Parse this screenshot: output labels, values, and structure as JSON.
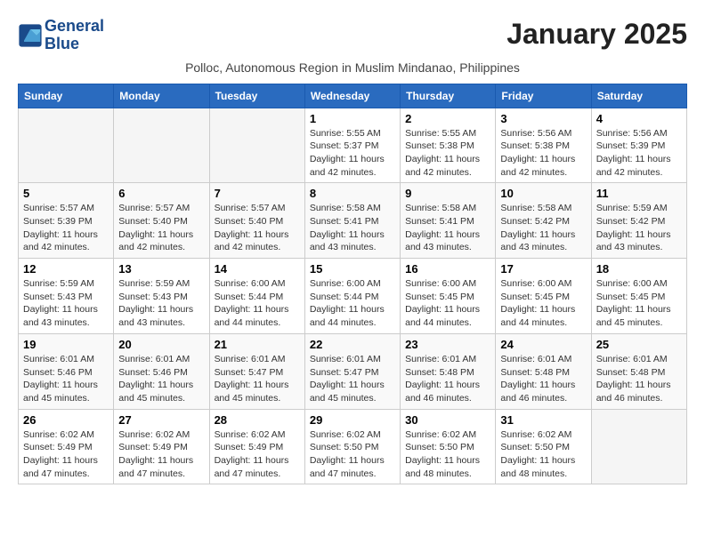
{
  "header": {
    "logo_line1": "General",
    "logo_line2": "Blue",
    "month_title": "January 2025",
    "subtitle": "Polloc, Autonomous Region in Muslim Mindanao, Philippines"
  },
  "weekdays": [
    "Sunday",
    "Monday",
    "Tuesday",
    "Wednesday",
    "Thursday",
    "Friday",
    "Saturday"
  ],
  "weeks": [
    [
      {
        "day": "",
        "info": ""
      },
      {
        "day": "",
        "info": ""
      },
      {
        "day": "",
        "info": ""
      },
      {
        "day": "1",
        "info": "Sunrise: 5:55 AM\nSunset: 5:37 PM\nDaylight: 11 hours\nand 42 minutes."
      },
      {
        "day": "2",
        "info": "Sunrise: 5:55 AM\nSunset: 5:38 PM\nDaylight: 11 hours\nand 42 minutes."
      },
      {
        "day": "3",
        "info": "Sunrise: 5:56 AM\nSunset: 5:38 PM\nDaylight: 11 hours\nand 42 minutes."
      },
      {
        "day": "4",
        "info": "Sunrise: 5:56 AM\nSunset: 5:39 PM\nDaylight: 11 hours\nand 42 minutes."
      }
    ],
    [
      {
        "day": "5",
        "info": "Sunrise: 5:57 AM\nSunset: 5:39 PM\nDaylight: 11 hours\nand 42 minutes."
      },
      {
        "day": "6",
        "info": "Sunrise: 5:57 AM\nSunset: 5:40 PM\nDaylight: 11 hours\nand 42 minutes."
      },
      {
        "day": "7",
        "info": "Sunrise: 5:57 AM\nSunset: 5:40 PM\nDaylight: 11 hours\nand 42 minutes."
      },
      {
        "day": "8",
        "info": "Sunrise: 5:58 AM\nSunset: 5:41 PM\nDaylight: 11 hours\nand 43 minutes."
      },
      {
        "day": "9",
        "info": "Sunrise: 5:58 AM\nSunset: 5:41 PM\nDaylight: 11 hours\nand 43 minutes."
      },
      {
        "day": "10",
        "info": "Sunrise: 5:58 AM\nSunset: 5:42 PM\nDaylight: 11 hours\nand 43 minutes."
      },
      {
        "day": "11",
        "info": "Sunrise: 5:59 AM\nSunset: 5:42 PM\nDaylight: 11 hours\nand 43 minutes."
      }
    ],
    [
      {
        "day": "12",
        "info": "Sunrise: 5:59 AM\nSunset: 5:43 PM\nDaylight: 11 hours\nand 43 minutes."
      },
      {
        "day": "13",
        "info": "Sunrise: 5:59 AM\nSunset: 5:43 PM\nDaylight: 11 hours\nand 43 minutes."
      },
      {
        "day": "14",
        "info": "Sunrise: 6:00 AM\nSunset: 5:44 PM\nDaylight: 11 hours\nand 44 minutes."
      },
      {
        "day": "15",
        "info": "Sunrise: 6:00 AM\nSunset: 5:44 PM\nDaylight: 11 hours\nand 44 minutes."
      },
      {
        "day": "16",
        "info": "Sunrise: 6:00 AM\nSunset: 5:45 PM\nDaylight: 11 hours\nand 44 minutes."
      },
      {
        "day": "17",
        "info": "Sunrise: 6:00 AM\nSunset: 5:45 PM\nDaylight: 11 hours\nand 44 minutes."
      },
      {
        "day": "18",
        "info": "Sunrise: 6:00 AM\nSunset: 5:45 PM\nDaylight: 11 hours\nand 45 minutes."
      }
    ],
    [
      {
        "day": "19",
        "info": "Sunrise: 6:01 AM\nSunset: 5:46 PM\nDaylight: 11 hours\nand 45 minutes."
      },
      {
        "day": "20",
        "info": "Sunrise: 6:01 AM\nSunset: 5:46 PM\nDaylight: 11 hours\nand 45 minutes."
      },
      {
        "day": "21",
        "info": "Sunrise: 6:01 AM\nSunset: 5:47 PM\nDaylight: 11 hours\nand 45 minutes."
      },
      {
        "day": "22",
        "info": "Sunrise: 6:01 AM\nSunset: 5:47 PM\nDaylight: 11 hours\nand 45 minutes."
      },
      {
        "day": "23",
        "info": "Sunrise: 6:01 AM\nSunset: 5:48 PM\nDaylight: 11 hours\nand 46 minutes."
      },
      {
        "day": "24",
        "info": "Sunrise: 6:01 AM\nSunset: 5:48 PM\nDaylight: 11 hours\nand 46 minutes."
      },
      {
        "day": "25",
        "info": "Sunrise: 6:01 AM\nSunset: 5:48 PM\nDaylight: 11 hours\nand 46 minutes."
      }
    ],
    [
      {
        "day": "26",
        "info": "Sunrise: 6:02 AM\nSunset: 5:49 PM\nDaylight: 11 hours\nand 47 minutes."
      },
      {
        "day": "27",
        "info": "Sunrise: 6:02 AM\nSunset: 5:49 PM\nDaylight: 11 hours\nand 47 minutes."
      },
      {
        "day": "28",
        "info": "Sunrise: 6:02 AM\nSunset: 5:49 PM\nDaylight: 11 hours\nand 47 minutes."
      },
      {
        "day": "29",
        "info": "Sunrise: 6:02 AM\nSunset: 5:50 PM\nDaylight: 11 hours\nand 47 minutes."
      },
      {
        "day": "30",
        "info": "Sunrise: 6:02 AM\nSunset: 5:50 PM\nDaylight: 11 hours\nand 48 minutes."
      },
      {
        "day": "31",
        "info": "Sunrise: 6:02 AM\nSunset: 5:50 PM\nDaylight: 11 hours\nand 48 minutes."
      },
      {
        "day": "",
        "info": ""
      }
    ]
  ]
}
